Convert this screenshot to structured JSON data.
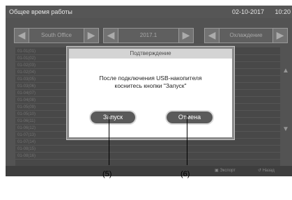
{
  "titlebar": {
    "title": "Общее время работы",
    "date": "02-10-2017",
    "time": "10:20"
  },
  "selectors": [
    {
      "value": "South Office",
      "prev_icon": "arrow-left-icon",
      "next_icon": "arrow-right-icon"
    },
    {
      "value": "2017.1",
      "prev_icon": "arrow-left-icon",
      "next_icon": "arrow-right-icon"
    },
    {
      "value": "Охлаждение",
      "prev_icon": "arrow-left-icon",
      "next_icon": "arrow-right-icon"
    }
  ],
  "table": {
    "rows": [
      {
        "label": "01-01(01)",
        "value": ""
      },
      {
        "label": "01-01(02)",
        "value": ""
      },
      {
        "label": "01-02(03)",
        "value": ""
      },
      {
        "label": "01-02(04)",
        "value": ""
      },
      {
        "label": "01-03(05)",
        "value": ""
      },
      {
        "label": "01-03(06)",
        "value": ""
      },
      {
        "label": "01-04(07)",
        "value": ""
      },
      {
        "label": "01-04(08)",
        "value": ""
      },
      {
        "label": "01-05(09)",
        "value": ""
      },
      {
        "label": "01-05(10)",
        "value": ""
      },
      {
        "label": "01-06(11)",
        "value": ""
      },
      {
        "label": "01-06(12)",
        "value": ""
      },
      {
        "label": "01-07(13)",
        "value": ""
      },
      {
        "label": "01-07(14)",
        "value": ""
      },
      {
        "label": "01-08(15)",
        "value": ""
      },
      {
        "label": "01-08(16)",
        "value": ""
      }
    ]
  },
  "bottombar": {
    "export_label": "Экспорт",
    "back_label": "Назад"
  },
  "dialog": {
    "title": "Подтверждение",
    "message_line1": "После подключения USB-накопителя",
    "message_line2": "коснитесь кнопки \"Запуск\"",
    "start_label": "Запуск",
    "cancel_label": "Отмена"
  },
  "callouts": {
    "start": "(5)",
    "cancel": "(6)"
  }
}
